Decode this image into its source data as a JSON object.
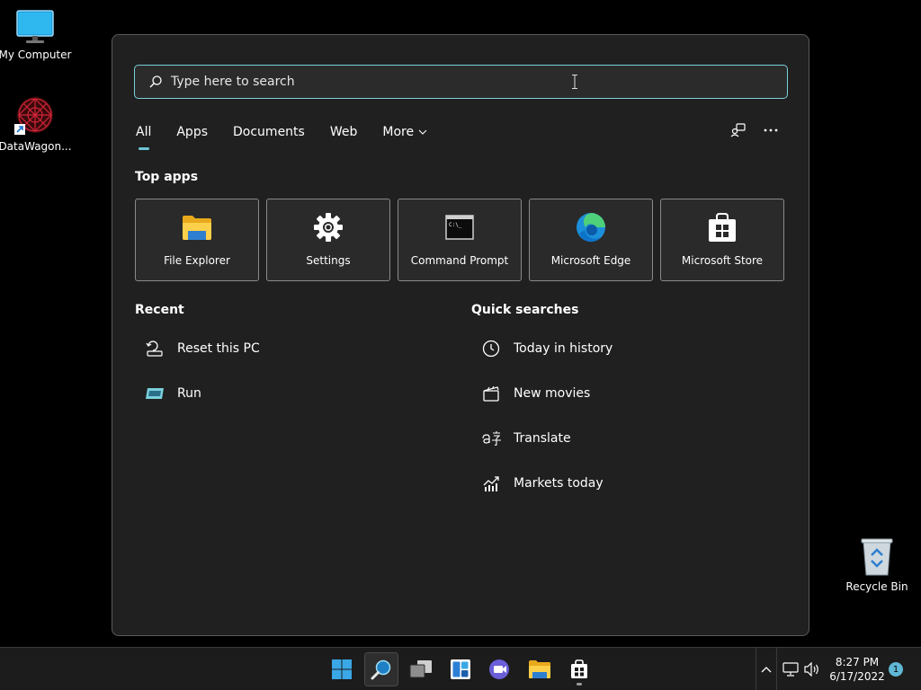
{
  "desktop": {
    "icons": [
      {
        "label": "My Computer"
      },
      {
        "label": "DataWagon..."
      },
      {
        "label": "Recycle Bin"
      }
    ]
  },
  "search": {
    "placeholder": "Type here to search",
    "value": ""
  },
  "tabs": [
    {
      "label": "All",
      "active": true
    },
    {
      "label": "Apps"
    },
    {
      "label": "Documents"
    },
    {
      "label": "Web"
    },
    {
      "label": "More"
    }
  ],
  "top_apps": {
    "title": "Top apps",
    "items": [
      {
        "label": "File Explorer",
        "icon": "folder-icon"
      },
      {
        "label": "Settings",
        "icon": "gear-icon"
      },
      {
        "label": "Command Prompt",
        "icon": "terminal-icon"
      },
      {
        "label": "Microsoft Edge",
        "icon": "edge-icon"
      },
      {
        "label": "Microsoft Store",
        "icon": "store-icon"
      }
    ]
  },
  "recent": {
    "title": "Recent",
    "items": [
      {
        "label": "Reset this PC",
        "icon": "reset-icon"
      },
      {
        "label": "Run",
        "icon": "run-icon"
      }
    ]
  },
  "quick_searches": {
    "title": "Quick searches",
    "items": [
      {
        "label": "Today in history",
        "icon": "clock-icon"
      },
      {
        "label": "New movies",
        "icon": "clapperboard-icon"
      },
      {
        "label": "Translate",
        "icon": "translate-icon"
      },
      {
        "label": "Markets today",
        "icon": "chart-icon"
      }
    ]
  },
  "tray": {
    "time": "8:27 PM",
    "date": "6/17/2022",
    "notifications": "1"
  },
  "colors": {
    "accent": "#7ad0dc",
    "panel_bg": "#202020",
    "taskbar_bg": "#1c1c1c"
  }
}
